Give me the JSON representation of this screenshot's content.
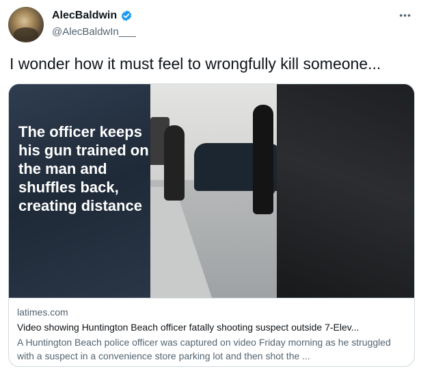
{
  "user": {
    "display_name": "AlecBaldwin",
    "handle": "@AlecBaldwIn___",
    "verified": true
  },
  "more_icon": "more-horizontal-icon",
  "tweet": {
    "text": "I wonder how it must feel to wrongfully kill someone..."
  },
  "card": {
    "overlay_text": "The officer keeps his gun trained on the man and shuffles back, creating distance",
    "domain": "latimes.com",
    "title": "Video showing Huntington Beach officer fatally shooting suspect outside 7-Elev...",
    "description": "A Huntington Beach police officer was captured on video Friday morning as he struggled with a suspect in a convenience store parking lot and then shot the ..."
  },
  "colors": {
    "verified_blue": "#1d9bf0",
    "secondary_text": "#536471",
    "primary_text": "#0f1419",
    "border": "#cfd9de"
  }
}
